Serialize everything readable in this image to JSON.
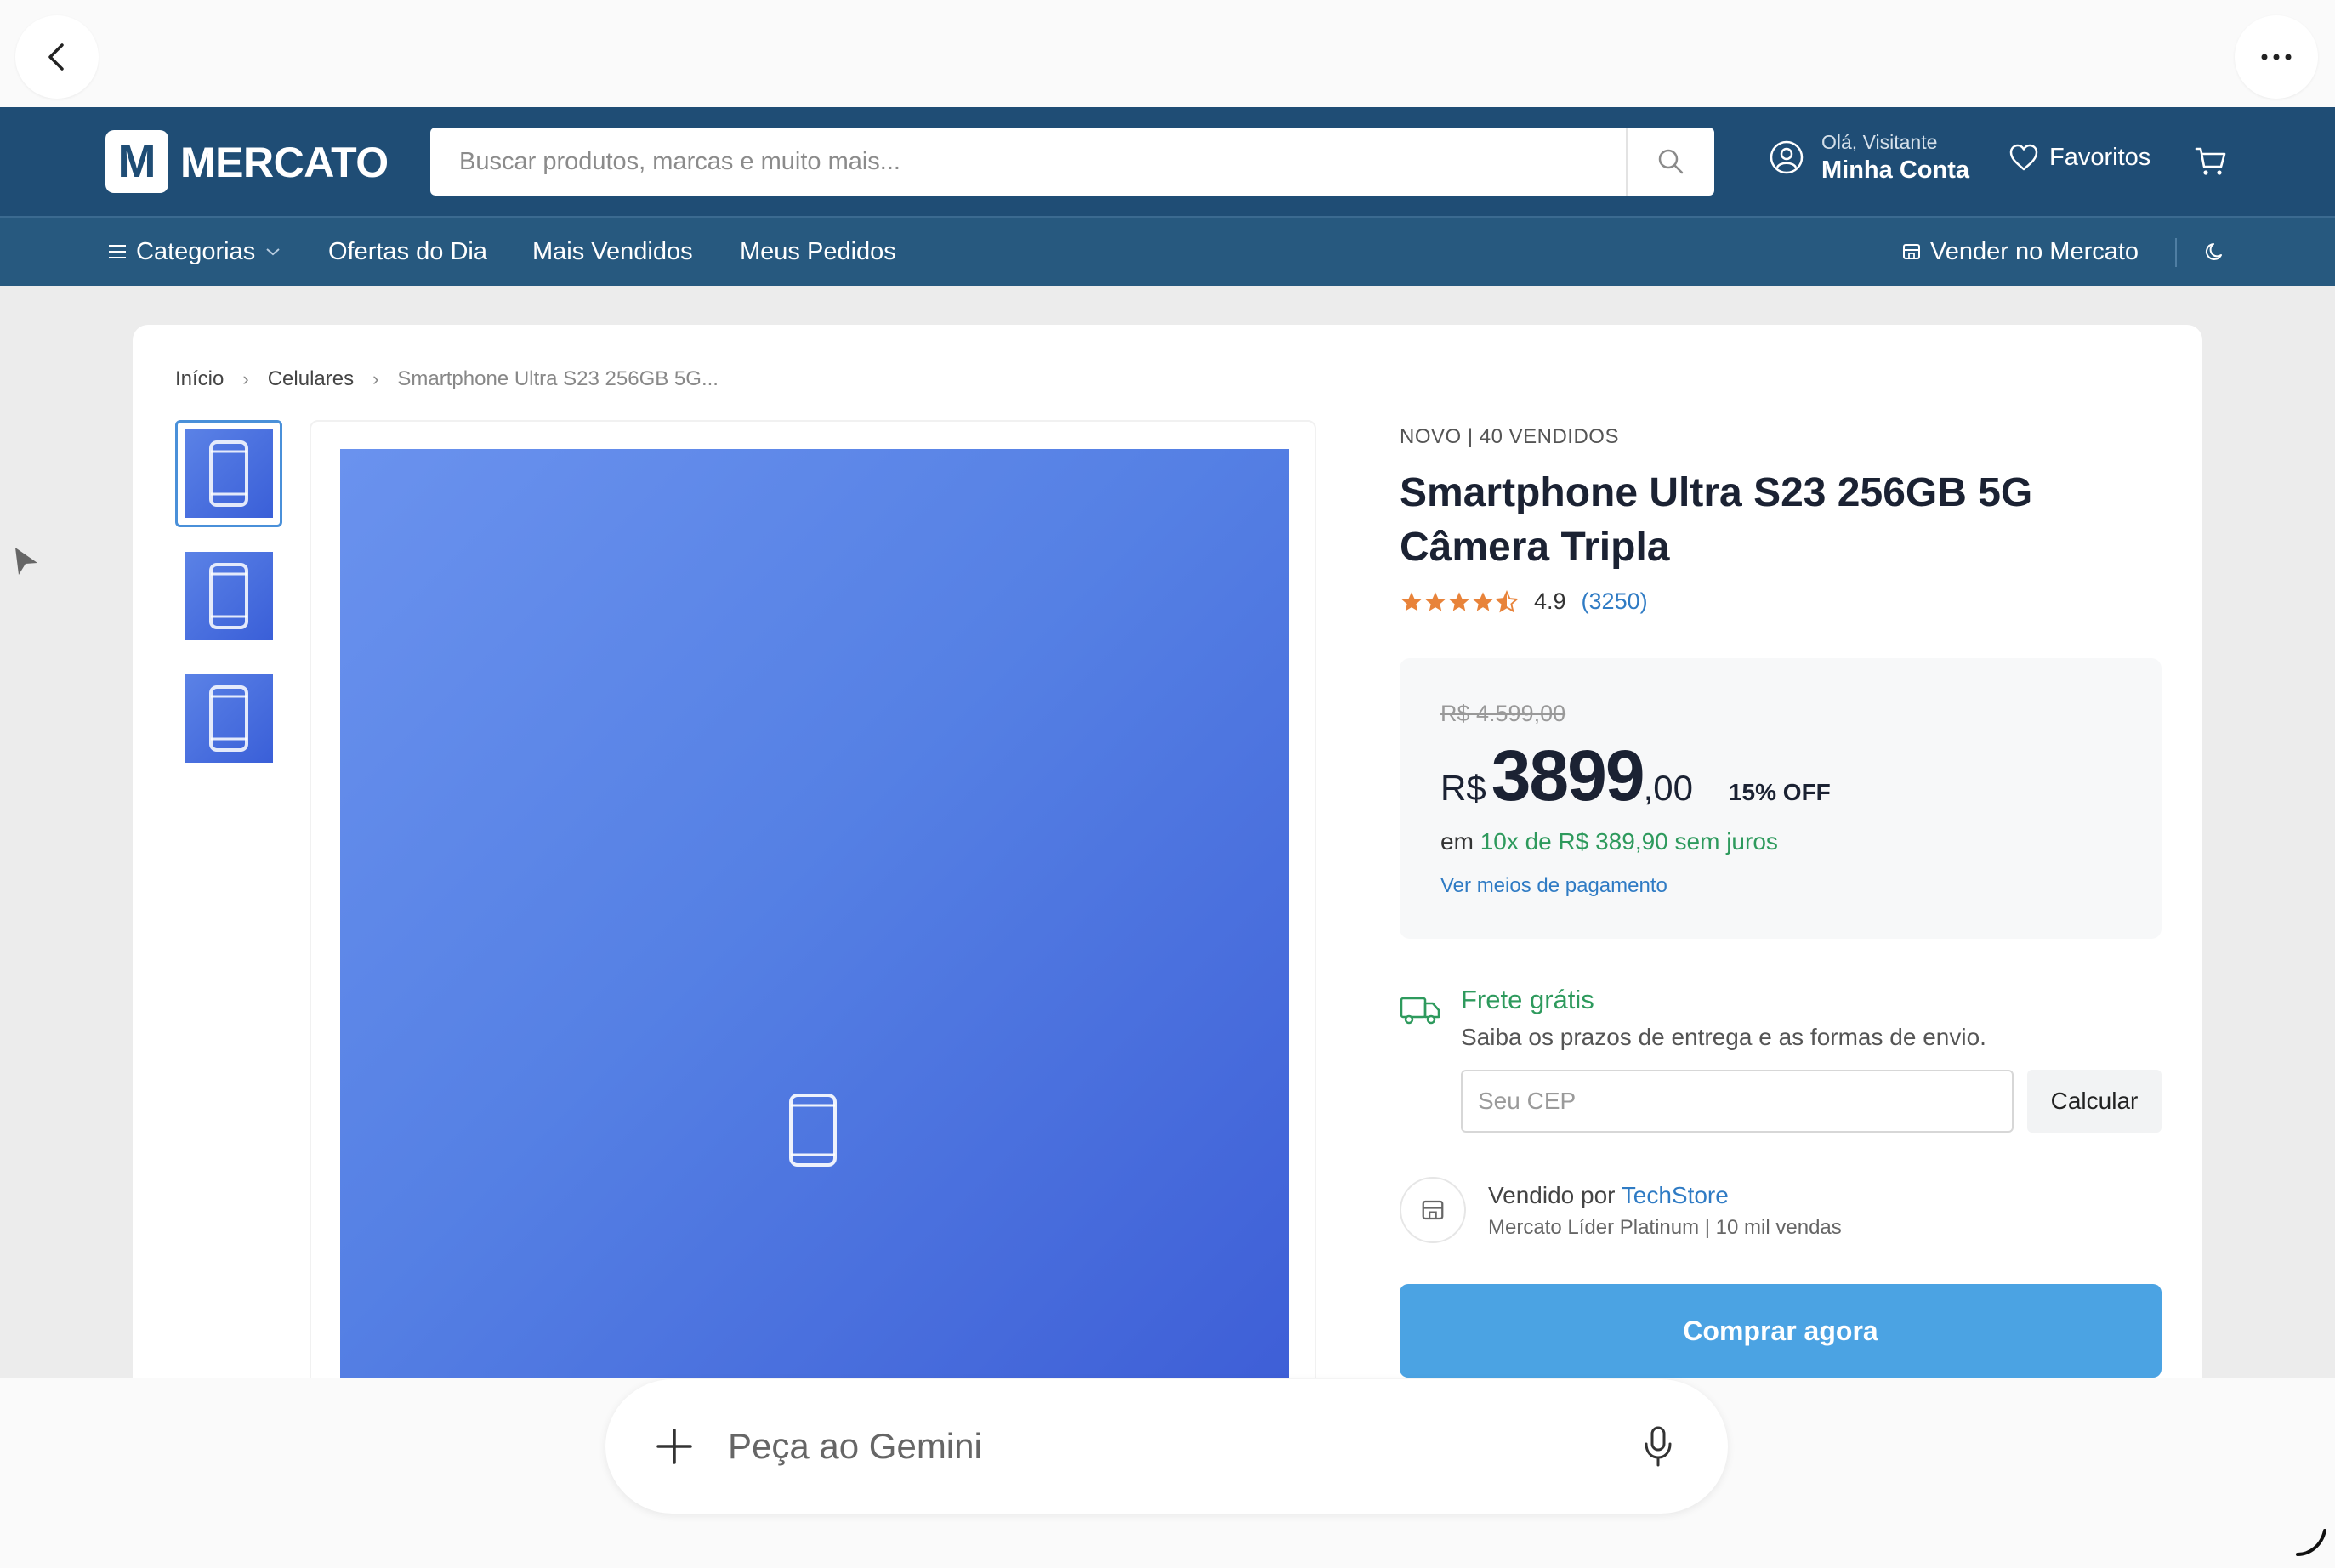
{
  "header": {
    "logo_letter": "M",
    "logo_text": "MERCATO",
    "search_placeholder": "Buscar produtos, marcas e muito mais...",
    "greeting": "Olá, Visitante",
    "account_label": "Minha Conta",
    "favorites_label": "Favoritos"
  },
  "subnav": {
    "categories": "Categorias",
    "deals": "Ofertas do Dia",
    "best_sellers": "Mais Vendidos",
    "orders": "Meus Pedidos",
    "sell": "Vender no Mercato"
  },
  "breadcrumb": {
    "home": "Início",
    "category": "Celulares",
    "current": "Smartphone Ultra S23 256GB 5G..."
  },
  "product": {
    "condition": "NOVO | 40 VENDIDOS",
    "title": "Smartphone Ultra S23 256GB 5G Câmera Tripla",
    "rating": 4.9,
    "rating_text": "4.9",
    "reviews": "(3250)",
    "old_price": "R$ 4.599,00",
    "currency": "R$",
    "price_int": "3899",
    "price_cents": ",00",
    "discount": "15% OFF",
    "installments_prefix": "em",
    "installments": "10x de R$ 389,90 sem juros",
    "payment_link": "Ver meios de pagamento"
  },
  "shipping": {
    "title": "Frete grátis",
    "subtitle": "Saiba os prazos de entrega e as formas de envio.",
    "cep_placeholder": "Seu CEP",
    "calc_label": "Calcular"
  },
  "seller": {
    "prefix": "Vendido por",
    "name": "TechStore",
    "details": "Mercato Líder Platinum | 10 mil vendas"
  },
  "buy_label": "Comprar agora",
  "assistant": {
    "prompt_placeholder": "Peça ao Gemini"
  },
  "colors": {
    "header_bg": "#1f4d75",
    "subnav_bg": "#27597f",
    "accent_blue": "#4ba3e3",
    "link_blue": "#2f7bc4",
    "green": "#2e9a5d",
    "star": "#e8833a"
  }
}
